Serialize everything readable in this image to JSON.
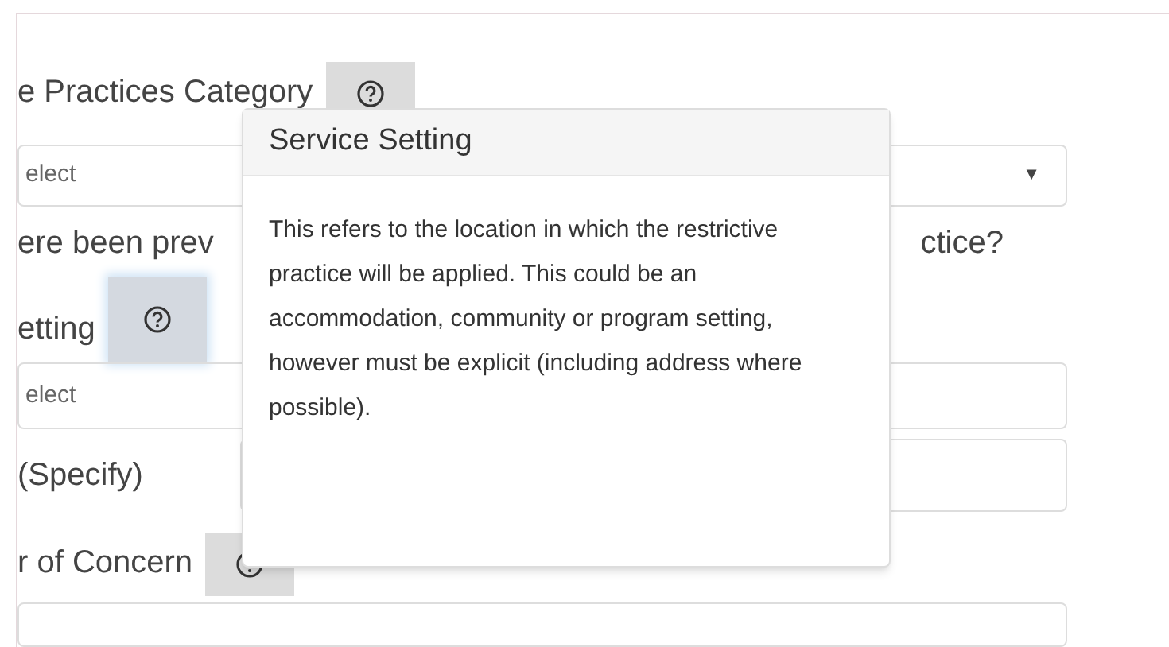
{
  "form": [
    {
      "kind": "label",
      "text": "e Practices Category",
      "help": {
        "active": false
      }
    },
    {
      "kind": "select",
      "value": "elect",
      "caret": "▼"
    },
    {
      "kind": "question",
      "parts": [
        "ere been prev",
        "ctice?"
      ]
    },
    {
      "kind": "label",
      "text": "etting",
      "help": {
        "active": true
      }
    },
    {
      "kind": "select",
      "value": "elect"
    },
    {
      "kind": "text-row",
      "text": "(Specify)"
    },
    {
      "kind": "label",
      "text": "r of Concern",
      "help": {
        "active": false
      }
    },
    {
      "kind": "input"
    }
  ],
  "popover": {
    "title": "Service Setting",
    "body": "This refers to the location in which the restrictive practice will be applied. This could be an accommodation, community or program setting, however must be explicit (including address where possible)."
  }
}
